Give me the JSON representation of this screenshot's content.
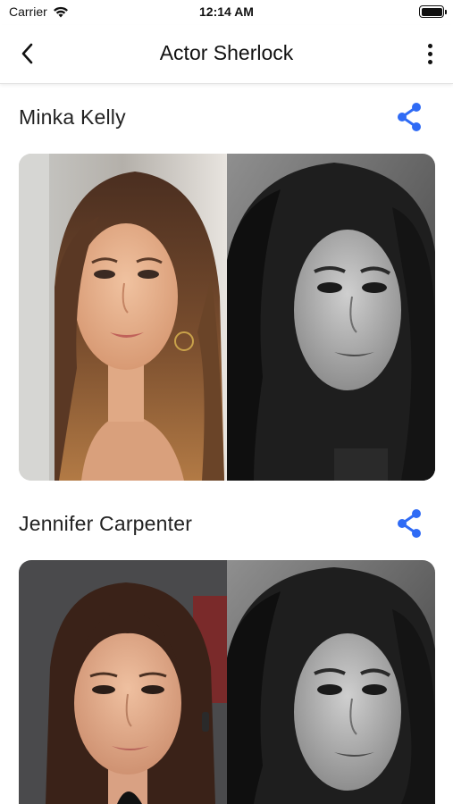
{
  "status": {
    "carrier": "Carrier",
    "time": "12:14 AM"
  },
  "nav": {
    "title": "Actor Sherlock",
    "back_icon": "chevron-left-icon",
    "more_icon": "more-vertical-icon"
  },
  "results": [
    {
      "name": "Minka Kelly",
      "share_icon": "share-icon"
    },
    {
      "name": "Jennifer Carpenter",
      "share_icon": "share-icon"
    }
  ],
  "colors": {
    "accent": "#2f6bf5",
    "divider": "#e3e3e3"
  }
}
